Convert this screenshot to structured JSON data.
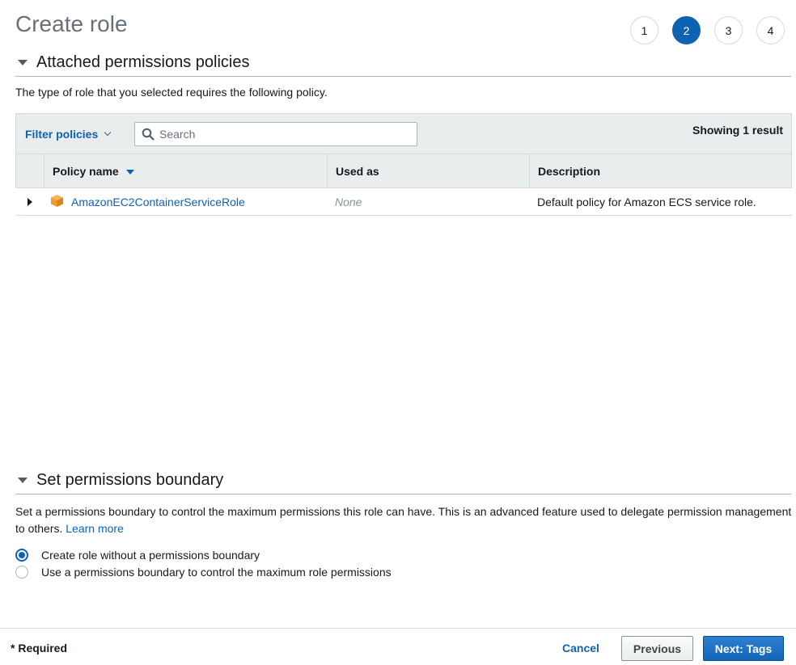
{
  "page": {
    "title": "Create role",
    "steps": [
      "1",
      "2",
      "3",
      "4"
    ],
    "active_step": "2"
  },
  "attached": {
    "section_title": "Attached permissions policies",
    "description": "The type of role that you selected requires the following policy.",
    "filter_label": "Filter policies",
    "search_placeholder": "Search",
    "showing_text": "Showing 1 result",
    "columns": {
      "policy_name": "Policy name",
      "used_as": "Used as",
      "description": "Description"
    },
    "rows": [
      {
        "icon": "policy-cube-icon",
        "policy_name": "AmazonEC2ContainerServiceRole",
        "used_as": "None",
        "description": "Default policy for Amazon ECS service role."
      }
    ]
  },
  "boundary": {
    "section_title": "Set permissions boundary",
    "description": "Set a permissions boundary to control the maximum permissions this role can have. This is an advanced feature used to delegate permission management to others.",
    "learn_more": "Learn more",
    "options": [
      {
        "label": "Create role without a permissions boundary",
        "checked": true
      },
      {
        "label": "Use a permissions boundary to control the maximum role permissions",
        "checked": false
      }
    ]
  },
  "footer": {
    "required": "* Required",
    "cancel": "Cancel",
    "previous": "Previous",
    "next": "Next: Tags"
  },
  "colors": {
    "accent": "#0f62b0",
    "policy_icon": "#ec9c2b"
  }
}
